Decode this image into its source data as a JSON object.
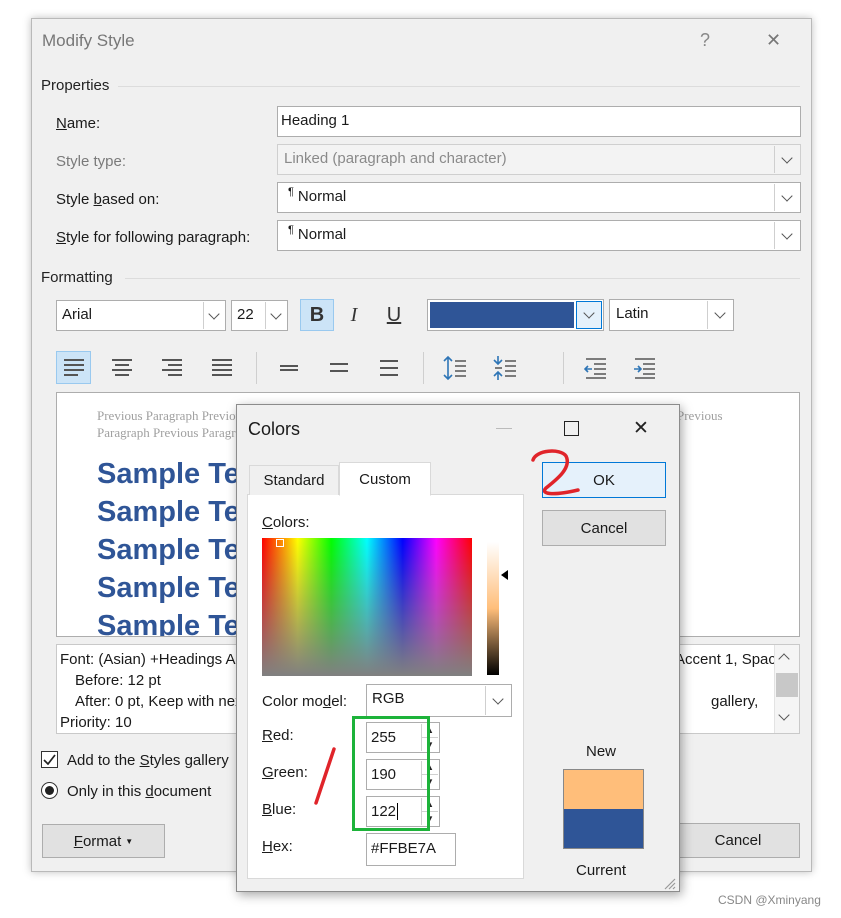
{
  "modify_style": {
    "title": "Modify Style",
    "help": "?",
    "close": "✕",
    "properties_header": "Properties",
    "name_label": "Name:",
    "name_value": "Heading 1",
    "style_type_label": "Style type:",
    "style_type_value": "Linked (paragraph and character)",
    "based_on_label": "Style based on:",
    "based_on_value": "Normal",
    "following_label": "Style for following paragraph:",
    "following_value": "Normal",
    "pilcrow": "¶",
    "formatting_header": "Formatting",
    "font_name": "Arial",
    "font_size": "22",
    "bold": "B",
    "italic": "I",
    "underline": "U",
    "font_color": "#2f5597",
    "script": "Latin",
    "preview": {
      "prev_line1": "Previous Paragraph Previous",
      "prev_line1_right": "Previous",
      "prev_line2": "Paragraph Previous Paragraph",
      "sample": [
        "Sample Text",
        "Sample Text",
        "Sample Text",
        "Sample Text",
        "Sample Text"
      ]
    },
    "description": {
      "line1_left": "Font: (Asian) +Headings Asian",
      "line1_right": "Accent 1, Space",
      "line2": "Before:  12 pt",
      "line3_left": "After:  0 pt, Keep with next",
      "line3_right": "gallery,",
      "line4": "Priority: 10"
    },
    "add_to_gallery": "Add to the Styles gallery",
    "only_this_doc": "Only in this document",
    "format_button": "Format",
    "cancel_button": "Cancel"
  },
  "colors": {
    "title": "Colors",
    "tab_standard": "Standard",
    "tab_custom": "Custom",
    "colors_label": "Colors:",
    "color_model_label": "Color model:",
    "color_model_value": "RGB",
    "red_label": "Red:",
    "red_value": "255",
    "green_label": "Green:",
    "green_value": "190",
    "blue_label": "Blue:",
    "blue_value": "122",
    "hex_label": "Hex:",
    "hex_value": "#FFBE7A",
    "ok_button": "OK",
    "cancel_button": "Cancel",
    "new_label": "New",
    "current_label": "Current",
    "new_color": "#ffbe7a",
    "current_color": "#2f5597"
  },
  "annotations": {
    "step1": "1",
    "step2": "2"
  },
  "watermark": "CSDN @Xminyang"
}
